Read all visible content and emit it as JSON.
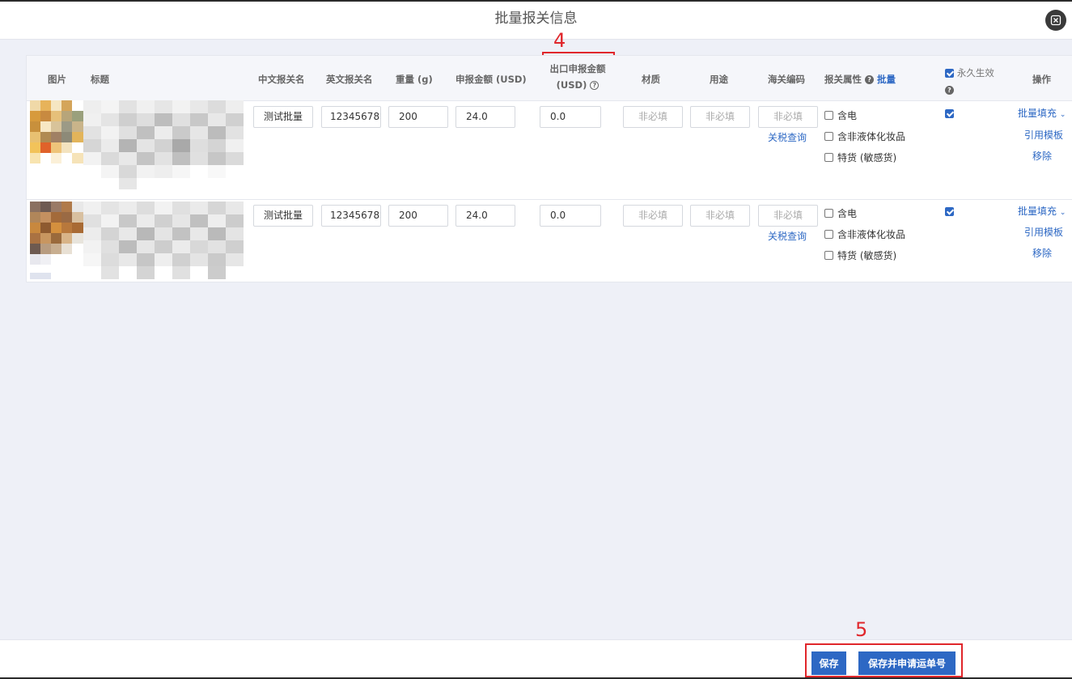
{
  "dialog": {
    "title": "批量报关信息",
    "close_icon": "close-icon"
  },
  "annotations": {
    "a4": "4",
    "a5": "5"
  },
  "table": {
    "headers": {
      "image": "图片",
      "title": "标题",
      "cn_name": "中文报关名",
      "en_name": "英文报关名",
      "weight": "重量 (g)",
      "declare_amount": "申报金额 (USD)",
      "export_amount_line1": "出口申报金额",
      "export_amount_line2": "(USD)",
      "material": "材质",
      "usage": "用途",
      "hs_code": "海关编码",
      "attributes": "报关属性",
      "attributes_batch": "批量",
      "permanent": "永久生效",
      "operation": "操作"
    },
    "rows": [
      {
        "cn_name": "测试批量",
        "en_name": "12345678",
        "weight": "200",
        "declare_amount": "24.0",
        "export_amount": "0.0",
        "material_placeholder": "非必填",
        "usage_placeholder": "非必填",
        "hs_code_placeholder": "非必填",
        "tariff_query": "关税查询",
        "attr_electric": "含电",
        "attr_liquid": "含非液体化妆品",
        "attr_special": "特货 (敏感货)",
        "permanent_checked": true,
        "op_batch_fill": "批量填充",
        "op_template": "引用模板",
        "op_remove": "移除"
      },
      {
        "cn_name": "测试批量",
        "en_name": "12345678",
        "weight": "200",
        "declare_amount": "24.0",
        "export_amount": "0.0",
        "material_placeholder": "非必填",
        "usage_placeholder": "非必填",
        "hs_code_placeholder": "非必填",
        "tariff_query": "关税查询",
        "attr_electric": "含电",
        "attr_liquid": "含非液体化妆品",
        "attr_special": "特货 (敏感货)",
        "permanent_checked": true,
        "op_batch_fill": "批量填充",
        "op_template": "引用模板",
        "op_remove": "移除"
      }
    ]
  },
  "footer": {
    "save": "保存",
    "save_and_apply": "保存并申请运单号"
  },
  "colors": {
    "accent": "#2d68c4",
    "annotation": "#e0262b",
    "background": "#eef0f7"
  }
}
